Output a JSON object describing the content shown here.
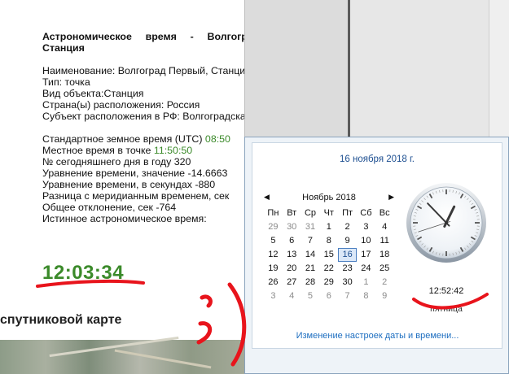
{
  "info": {
    "title": "Астрономическое время - Волгоград Первый, Станция",
    "lines": {
      "name": "Наименование: Волгоград Первый, Станция",
      "type": "Тип: точка",
      "kind": "Вид объекта:Станция",
      "country": "Страна(ы) расположения: Россия",
      "subject": "Субъект расположения в РФ: Волгоградская область",
      "utc_label": "Стандартное земное время (UTC) ",
      "utc_value": "08:50",
      "local_label": "Местное время в точке ",
      "local_value": "11:50:50",
      "day_of_year": "№ сегодняшнего дня в году 320",
      "eq_value": "Уравнение времени, значение -14.6663",
      "eq_seconds": "Уравнение времени, в секундах -880",
      "meridian": "Разница с меридианным временем, сек",
      "total": "Общее отклонение, сек -764",
      "true_time": "Истинное астрономическое время:"
    },
    "big_time": "12:03:34",
    "map_link": "спутниковой карте"
  },
  "popup": {
    "date_header": "16 ноября 2018 г.",
    "month": "Ноябрь 2018",
    "weekdays": [
      "Пн",
      "Вт",
      "Ср",
      "Чт",
      "Пт",
      "Сб",
      "Вс"
    ],
    "days": [
      {
        "d": "29",
        "dim": true
      },
      {
        "d": "30",
        "dim": true
      },
      {
        "d": "31",
        "dim": true
      },
      {
        "d": "1"
      },
      {
        "d": "2"
      },
      {
        "d": "3"
      },
      {
        "d": "4"
      },
      {
        "d": "5"
      },
      {
        "d": "6"
      },
      {
        "d": "7"
      },
      {
        "d": "8"
      },
      {
        "d": "9"
      },
      {
        "d": "10"
      },
      {
        "d": "11"
      },
      {
        "d": "12"
      },
      {
        "d": "13"
      },
      {
        "d": "14"
      },
      {
        "d": "15"
      },
      {
        "d": "16",
        "today": true
      },
      {
        "d": "17"
      },
      {
        "d": "18"
      },
      {
        "d": "19"
      },
      {
        "d": "20"
      },
      {
        "d": "21"
      },
      {
        "d": "22"
      },
      {
        "d": "23"
      },
      {
        "d": "24"
      },
      {
        "d": "25"
      },
      {
        "d": "26"
      },
      {
        "d": "27"
      },
      {
        "d": "28"
      },
      {
        "d": "29"
      },
      {
        "d": "30"
      },
      {
        "d": "1",
        "dim": true
      },
      {
        "d": "2",
        "dim": true
      },
      {
        "d": "3",
        "dim": true
      },
      {
        "d": "4",
        "dim": true
      },
      {
        "d": "5",
        "dim": true
      },
      {
        "d": "6",
        "dim": true
      },
      {
        "d": "7",
        "dim": true
      },
      {
        "d": "8",
        "dim": true
      },
      {
        "d": "9",
        "dim": true
      }
    ],
    "time": "12:52:42",
    "weekday": "пятница",
    "settings_link": "Изменение настроек даты и времени...",
    "clock_hands": {
      "hour": 12,
      "minute": 52,
      "second": 42
    }
  },
  "colors": {
    "green": "#3b8a2a",
    "link": "#1d6ec0",
    "marker": "#e8141c"
  }
}
